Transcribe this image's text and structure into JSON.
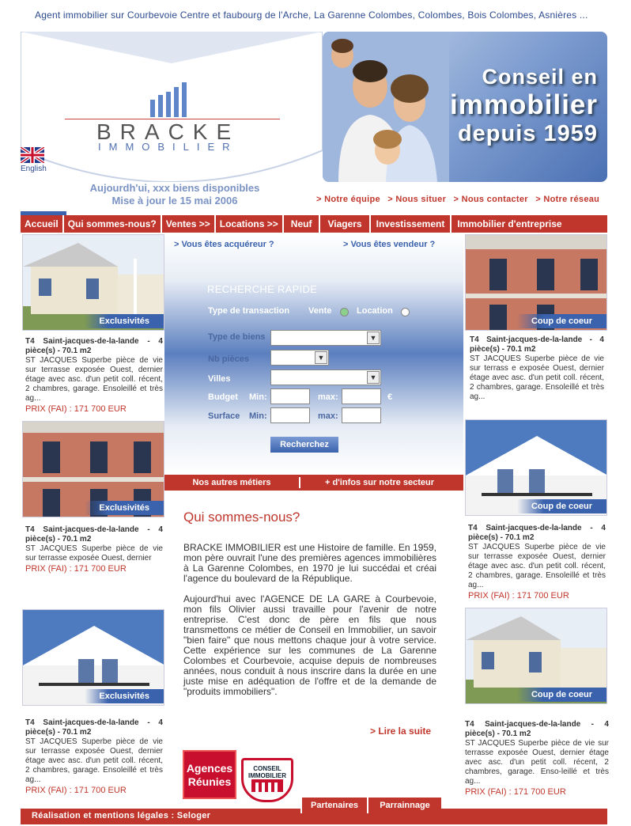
{
  "tagline": "Agent immobilier sur Courbevoie Centre et faubourg de l'Arche, La Garenne Colombes, Colombes, Bois Colombes, Asnières ...",
  "logo": {
    "name": "BRACKE",
    "sub": "IMMOBILIER"
  },
  "language": {
    "label": "English",
    "icon": "uk-flag-icon"
  },
  "availability": {
    "line1": "Aujourdh'ui, xxx biens disponibles",
    "line2": "Mise à jour le 15 mai 2006"
  },
  "hero": {
    "line1": "Conseil en",
    "line2": "immobilier",
    "line3": "depuis 1959"
  },
  "top_links": [
    "> Notre équipe",
    "> Nous situer",
    "> Nous contacter",
    "> Notre réseau"
  ],
  "nav": [
    "Accueil",
    "Qui sommes-nous?",
    "Ventes >>",
    "Locations >>",
    "Neuf",
    "Viagers",
    "Investissement",
    "Immobilier d'entreprise"
  ],
  "left_props": [
    {
      "tag": "Exclusivités",
      "title": "T4 Saint-jacques-de-la-lande - 4 pièce(s) - 70.1 m2",
      "desc": "ST JACQUES Superbe pièce de vie sur terrasse exposée Ouest, dernier étage avec asc. d'un petit coll. récent, 2 chambres, garage. Ensoleillé et très ag...",
      "price": "PRIX (FAI) : 171 700 EUR"
    },
    {
      "tag": "Exclusivités",
      "title": "T4 Saint-jacques-de-la-lande - 4 pièce(s) - 70.1 m2",
      "desc": "ST JACQUES Superbe pièce de vie sur terrasse exposée Ouest, dernier",
      "price": "PRIX (FAI) : 171 700 EUR"
    },
    {
      "tag": "Exclusivités",
      "title": "T4 Saint-jacques-de-la-lande - 4 pièce(s) - 70.1 m2",
      "desc": "ST JACQUES Superbe pièce de vie sur terrasse exposée Ouest, dernier étage avec asc. d'un petit coll. récent, 2 chambres, garage. Ensoleillé et très ag...",
      "price": "PRIX (FAI) : 171 700 EUR"
    }
  ],
  "right_props": [
    {
      "tag": "Coup de coeur",
      "title": "T4 Saint-jacques-de-la-lande - 4 pièce(s) - 70.1 m2",
      "desc": "ST JACQUES Superbe pièce de vie sur terrass e exposée Ouest, dernier étage avec asc. d'un petit coll. récent, 2 chambres, garage. Ensoleillé et très ag...",
      "price": ""
    },
    {
      "tag": "Coup de coeur",
      "title": "T4 Saint-jacques-de-la-lande - 4 pièce(s) - 70.1 m2",
      "desc": "ST JACQUES Superbe pièce de vie sur terrasse exposée Ouest, dernier étage avec asc. d'un petit coll. récent, 2 chambres, garage. Ensoleillé et très ag...",
      "price": "PRIX (FAI) : 171 700 EUR"
    },
    {
      "tag": "Coup de coeur",
      "title": "T4 Saint-jacques-de-la-lande - 4 pièce(s) - 70.1 m2",
      "desc": "ST JACQUES Superbe pièce de vie sur terrasse exposée Ouest, dernier étage avec asc. d'un petit coll. récent, 2 chambres, garage. Enso-leillé et très ag...",
      "price": "PRIX (FAI) : 171 700 EUR"
    }
  ],
  "acquereur": "> Vous êtes acquéreur ?",
  "vendeur": "> Vous êtes vendeur ?",
  "search": {
    "title": "RECHERCHE RAPIDE",
    "transaction_label": "Type de transaction",
    "vente": "Vente",
    "location": "Location",
    "type_biens": "Type de biens",
    "nb_pieces": "Nb pièces",
    "villes": "Villes",
    "budget": "Budget",
    "surface": "Surface",
    "min": "Min:",
    "max": "max:",
    "euro": "€",
    "button": "Recherchez"
  },
  "center_bar": [
    "Nos autres métiers",
    "+ d'infos sur notre secteur"
  ],
  "about": {
    "title": "Qui sommes-nous?",
    "p1": "BRACKE IMMOBILIER est une Histoire de famille. En 1959, mon père ouvrait l'une des premières agences immobilières à La Garenne Colombes, en 1970 je lui succédai et créai l'agence du boulevard de la République.",
    "p2": "Aujourd'hui avec l'AGENCE DE LA GARE à Courbevoie, mon fils Olivier aussi travaille pour l'avenir de notre entreprise. C'est donc de père en fils que nous transmettons ce métier de Conseil en Immobilier, un savoir \"bien faire\" que nous mettons chaque jour à votre service. Cette expérience sur les communes de La Garenne Colombes et Courbevoie, acquise depuis de nombreuses années, nous conduit à nous inscrire dans la durée en une juste mise en adéquation de l'offre et de la demande de \"produits immobiliers\".",
    "readmore": "> Lire la suite"
  },
  "badges": {
    "agences": "Agences Réunies",
    "conseil": "CONSEIL IMMOBILIER"
  },
  "bottom_links": [
    "Partenaires",
    "Parrainnage"
  ],
  "footer": "Réalisation et mentions légales : Seloger",
  "colors": {
    "brand_red": "#c0362c",
    "brand_blue": "#3a62ad"
  }
}
